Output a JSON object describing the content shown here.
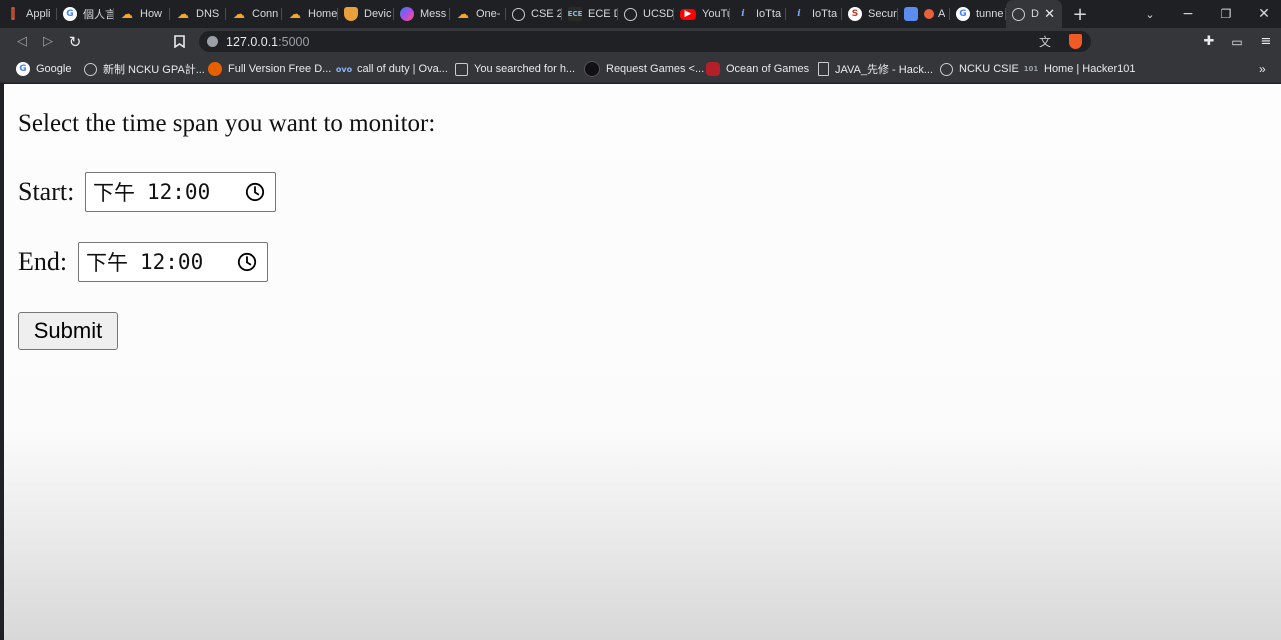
{
  "tabs": [
    {
      "label": "Appli",
      "icon": "bar-icon"
    },
    {
      "label": "個人言",
      "icon": "google-icon"
    },
    {
      "label": "How",
      "icon": "cloud-icon"
    },
    {
      "label": "DNS",
      "icon": "cloud-icon"
    },
    {
      "label": "Conn",
      "icon": "cloud-icon"
    },
    {
      "label": "Home",
      "icon": "cloud-icon"
    },
    {
      "label": "Devic",
      "icon": "shield-icon"
    },
    {
      "label": "Mess",
      "icon": "messenger-icon"
    },
    {
      "label": "One-",
      "icon": "cloud-icon"
    },
    {
      "label": "CSE 2",
      "icon": "globe-icon"
    },
    {
      "label": "ECE D",
      "icon": "ece-icon"
    },
    {
      "label": "UCSD",
      "icon": "globe-icon"
    },
    {
      "label": "YouTu",
      "icon": "youtube-icon"
    },
    {
      "label": "IoTta",
      "icon": "info-icon"
    },
    {
      "label": "IoTta",
      "icon": "info-icon"
    },
    {
      "label": "Secur",
      "icon": "security-icon"
    },
    {
      "label": "A",
      "icon": "app-icon"
    },
    {
      "label": "tunne",
      "icon": "google-icon"
    },
    {
      "label": "D",
      "icon": "globe-icon",
      "active": true
    }
  ],
  "browser": {
    "url_host": "127.0.0.1",
    "url_port": ":5000"
  },
  "bookmarks": [
    {
      "label": "Google",
      "icon": "google-icon"
    },
    {
      "label": "新制 NCKU GPA計...",
      "icon": "globe-icon"
    },
    {
      "label": "Full Version Free D...",
      "icon": "firefox-icon"
    },
    {
      "label": "call of duty | Ova...",
      "icon": "ova-icon"
    },
    {
      "label": "You searched for h...",
      "icon": "page-icon"
    },
    {
      "label": "Request Games <...",
      "icon": "mask-icon"
    },
    {
      "label": "Ocean of Games",
      "icon": "ocean-icon"
    },
    {
      "label": "JAVA_先修 - Hack...",
      "icon": "doc-icon"
    },
    {
      "label": "NCKU CSIE",
      "icon": "globe-icon"
    },
    {
      "label": "Home | Hacker101",
      "icon": "hacker101-icon"
    }
  ],
  "page": {
    "heading": "Select the time span you want to monitor:",
    "start_label": "Start:",
    "start_ampm": "下午",
    "start_time": "12:00",
    "end_label": "End:",
    "end_ampm": "下午",
    "end_time": "12:00",
    "submit_label": "Submit"
  }
}
